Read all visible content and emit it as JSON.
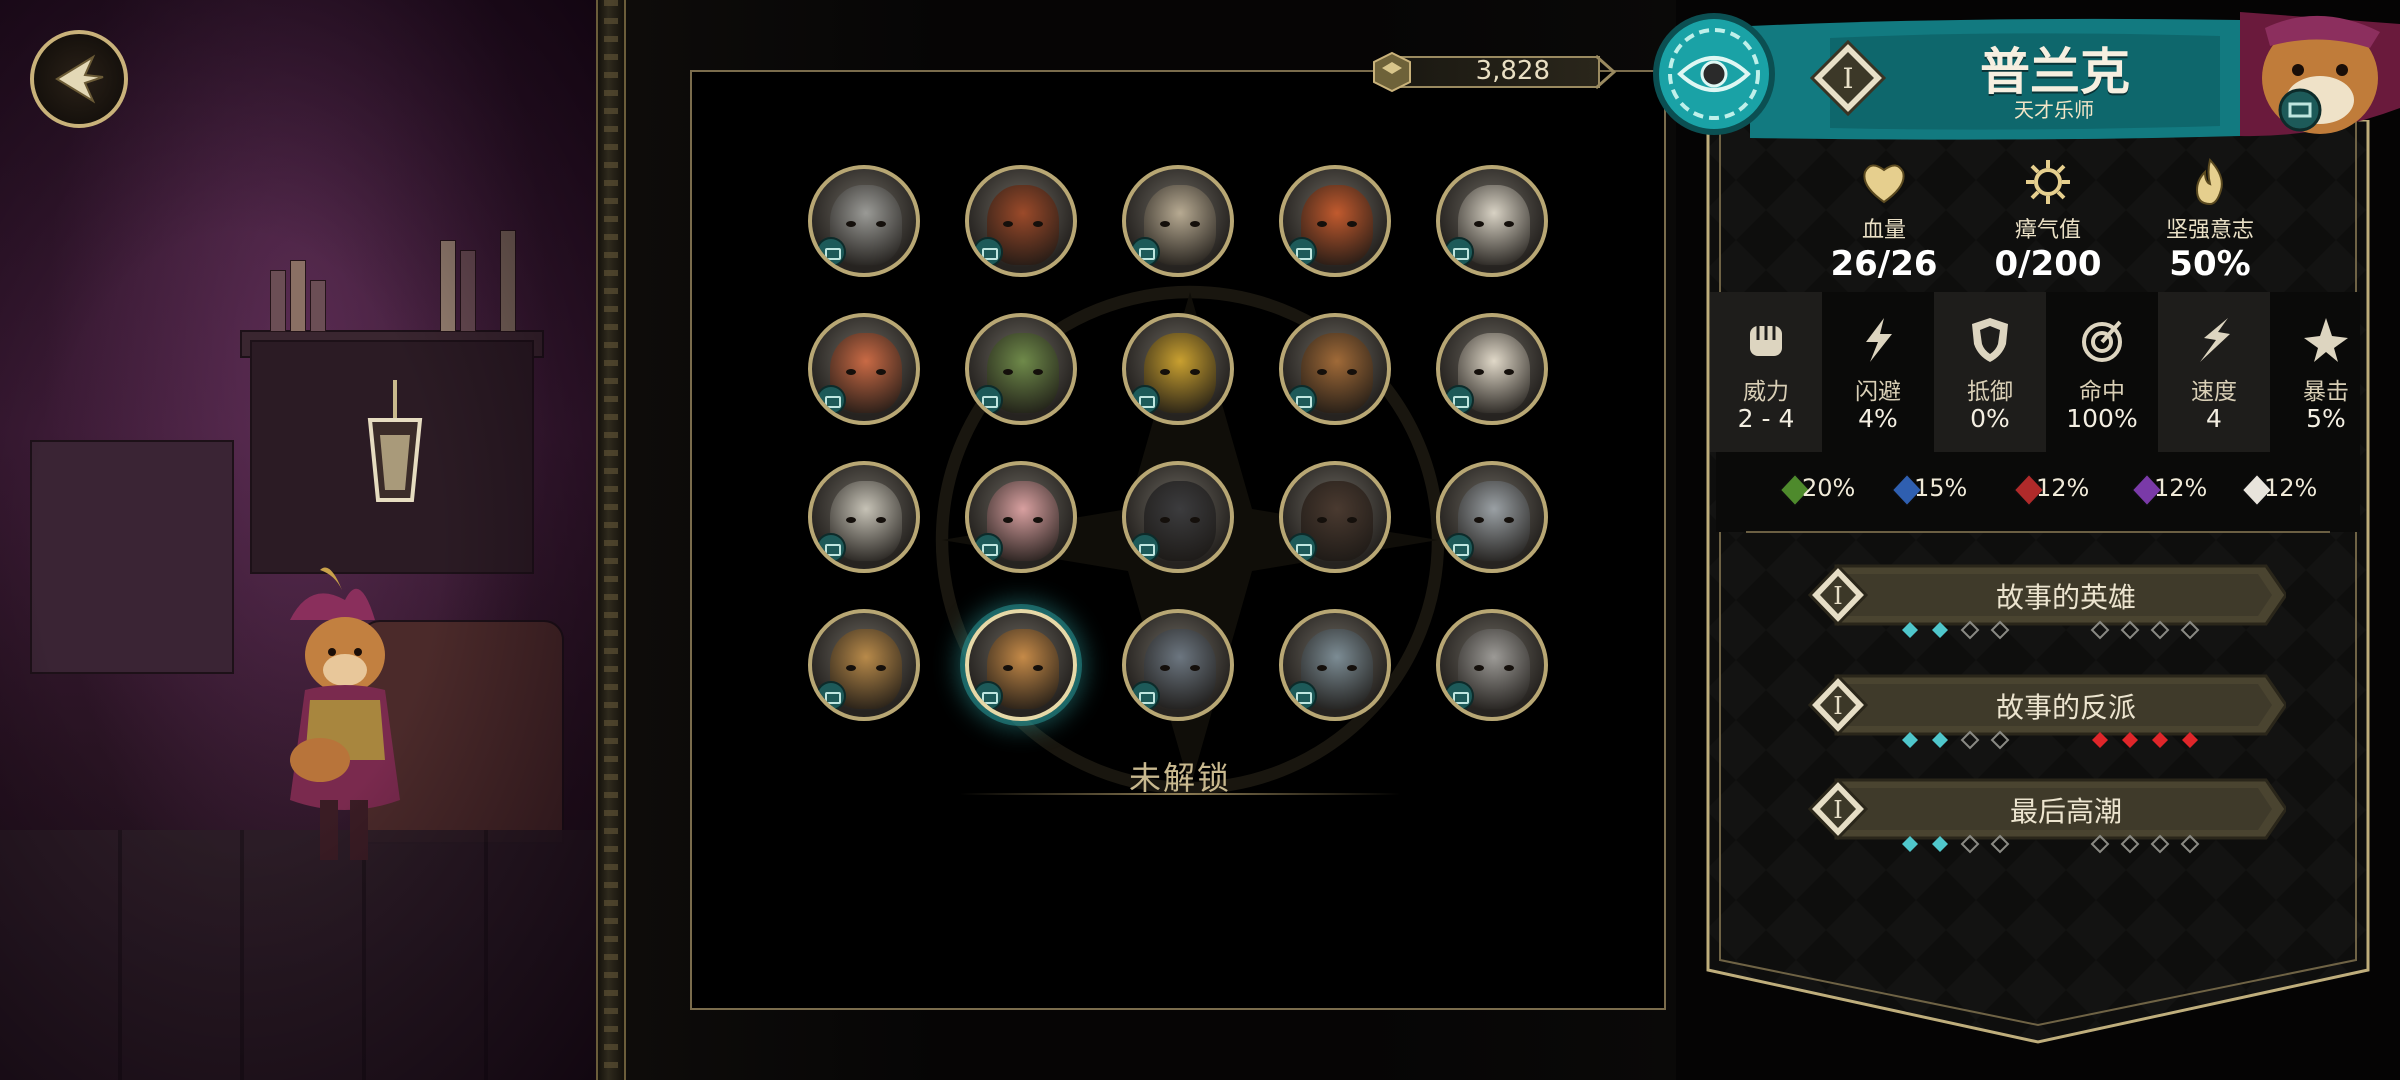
{
  "currency": {
    "value": "3,828",
    "icon": "gold-cube-icon"
  },
  "hero": {
    "name": "普兰克",
    "title": "天才乐师",
    "level": "I",
    "class_icon": "bard-icon"
  },
  "vitals": [
    {
      "label": "血量",
      "value": "26/26",
      "icon": "heart-icon"
    },
    {
      "label": "瘴气值",
      "value": "0/200",
      "icon": "miasma-icon"
    },
    {
      "label": "坚强意志",
      "value": "50%",
      "icon": "resolve-flame-icon"
    }
  ],
  "attributes": [
    {
      "label": "威力",
      "value": "2 - 4",
      "icon": "fist-icon"
    },
    {
      "label": "闪避",
      "value": "4%",
      "icon": "dodge-icon"
    },
    {
      "label": "抵御",
      "value": "0%",
      "icon": "shield-icon"
    },
    {
      "label": "命中",
      "value": "100%",
      "icon": "target-icon"
    },
    {
      "label": "速度",
      "value": "4",
      "icon": "speed-icon"
    },
    {
      "label": "暴击",
      "value": "5%",
      "icon": "crit-icon"
    }
  ],
  "resistances": [
    {
      "value": "20%",
      "color": "#4e8a2c"
    },
    {
      "value": "15%",
      "color": "#2f5fb0"
    },
    {
      "value": "12%",
      "color": "#b02a2a"
    },
    {
      "value": "12%",
      "color": "#7a3aa8"
    },
    {
      "value": "12%",
      "color": "#e8e4dc"
    }
  ],
  "trinket_slots": [
    {
      "level": "I",
      "label": "故事的英雄"
    },
    {
      "level": "I",
      "label": "故事的反派"
    },
    {
      "level": "I",
      "label": "最后高潮"
    }
  ],
  "roster": {
    "unlock_label": "未解锁",
    "selected_index": 16,
    "portraits": [
      {
        "name": "knight-bird-portrait",
        "tone": "#9a9a96"
      },
      {
        "name": "red-beast-portrait",
        "tone": "#9b4a2a"
      },
      {
        "name": "old-rat-portrait",
        "tone": "#b7aa92"
      },
      {
        "name": "fox-warrior-portrait",
        "tone": "#c15a2e"
      },
      {
        "name": "hooded-monk-portrait",
        "tone": "#d8d2c4"
      },
      {
        "name": "fox-rogue-portrait",
        "tone": "#c96a45"
      },
      {
        "name": "lizard-portrait",
        "tone": "#6f8a4a"
      },
      {
        "name": "rooster-portrait",
        "tone": "#c9a030"
      },
      {
        "name": "badger-portrait",
        "tone": "#a06a38"
      },
      {
        "name": "feathered-cat-portrait",
        "tone": "#e0d8c8"
      },
      {
        "name": "goose-knight-portrait",
        "tone": "#c6c2b6"
      },
      {
        "name": "pig-portrait",
        "tone": "#d8a0a0"
      },
      {
        "name": "shadow-wolf-portrait",
        "tone": "#3c3c3e"
      },
      {
        "name": "dark-boar-portrait",
        "tone": "#4a3a30"
      },
      {
        "name": "ram-portrait",
        "tone": "#9aa0a4"
      },
      {
        "name": "goggles-mouse-portrait",
        "tone": "#b88a4a"
      },
      {
        "name": "dog-bard-portrait",
        "tone": "#c58a48"
      },
      {
        "name": "armored-rat-portrait",
        "tone": "#6c7680"
      },
      {
        "name": "owl-portrait",
        "tone": "#7c8c94"
      },
      {
        "name": "grey-mouse-portrait",
        "tone": "#9c9a96"
      }
    ]
  },
  "colors": {
    "accent_teal": "#2aa6a8",
    "frame_gold": "#b8a774",
    "pip_teal": "#4fc7cc",
    "pip_red": "#e0262a"
  }
}
